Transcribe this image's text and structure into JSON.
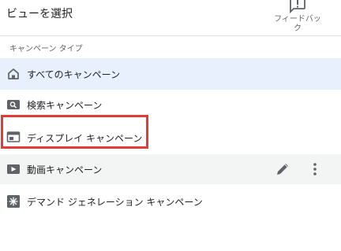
{
  "header": {
    "title": "ビューを選択",
    "feedback_label": "フィードバック"
  },
  "section": {
    "label": "キャンペーン タイプ"
  },
  "campaign_types": [
    {
      "label": "すべてのキャンペーン",
      "icon": "home-icon",
      "state": "selected"
    },
    {
      "label": "検索キャンペーン",
      "icon": "search-icon",
      "state": "default"
    },
    {
      "label": "ディスプレイ キャンペーン",
      "icon": "display-icon",
      "state": "annotated"
    },
    {
      "label": "動画キャンペーン",
      "icon": "video-icon",
      "state": "hover"
    },
    {
      "label": "デマンド ジェネレーション キャンペーン",
      "icon": "demand-gen-icon",
      "state": "default"
    }
  ],
  "row_actions": {
    "edit_icon": "pencil-icon",
    "more_icon": "more-vert-icon"
  },
  "colors": {
    "selected_background": "#e8f0fe",
    "hover_background": "#f3f5f5",
    "annotation_outline": "#e53935",
    "icon_color": "#5f6368"
  }
}
